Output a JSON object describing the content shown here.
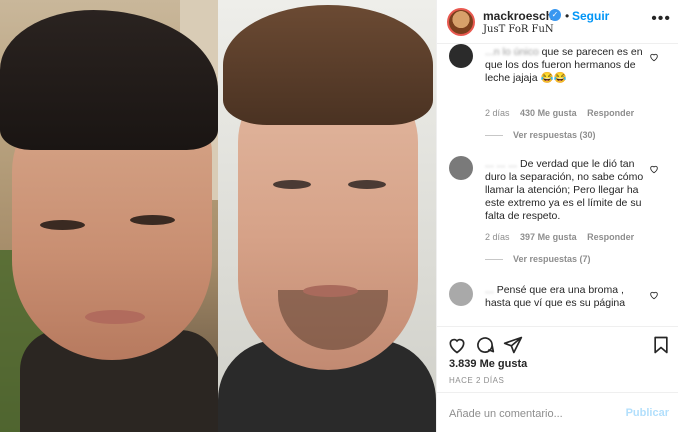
{
  "header": {
    "username": "mackroesch",
    "dot": "•",
    "follow_label": "Seguir",
    "subtitle": "JusT FoR FuN"
  },
  "comments": [
    {
      "text_hidden": "...n lo único",
      "text": "que se parecen es en que los dos fueron hermanos de leche jajaja 😂😂",
      "age": "2 días",
      "likes": "430 Me gusta",
      "reply": "Responder",
      "view_replies": "Ver respuestas (30)"
    },
    {
      "text_hidden": "... ... ...",
      "text": "De verdad que le dió tan duro la separación, no sabe cómo llamar la atención; Pero llegar ha este extremo ya es el límite de su falta de respeto.",
      "age": "2 días",
      "likes": "397 Me gusta",
      "reply": "Responder",
      "view_replies": "Ver respuestas (7)"
    },
    {
      "text_hidden": "...",
      "text": "Pensé que era una broma , hasta que ví que es su página"
    }
  ],
  "likes_count": "3.839 Me gusta",
  "date": "HACE 2 DÍAS",
  "add_comment": {
    "placeholder": "Añade un comentario...",
    "publish_label": "Publicar"
  }
}
